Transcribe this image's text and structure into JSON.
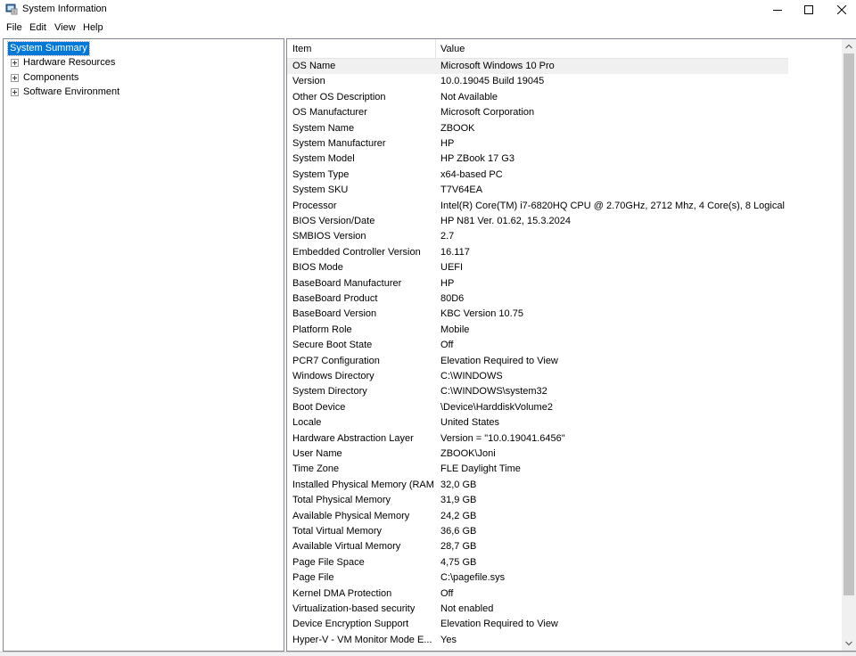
{
  "window": {
    "title": "System Information",
    "icon": "system-information-icon",
    "controls": [
      "minimize-icon",
      "maximize-icon",
      "close-icon"
    ]
  },
  "menu": {
    "file": "File",
    "edit": "Edit",
    "view": "View",
    "help": "Help"
  },
  "tree": {
    "selected": "System Summary",
    "items": [
      "Hardware Resources",
      "Components",
      "Software Environment"
    ]
  },
  "table": {
    "headers": {
      "item": "Item",
      "value": "Value"
    },
    "rows": [
      {
        "item": "OS Name",
        "value": "Microsoft Windows 10 Pro"
      },
      {
        "item": "Version",
        "value": "10.0.19045 Build 19045"
      },
      {
        "item": "Other OS Description",
        "value": "Not Available"
      },
      {
        "item": "OS Manufacturer",
        "value": "Microsoft Corporation"
      },
      {
        "item": "System Name",
        "value": "ZBOOK"
      },
      {
        "item": "System Manufacturer",
        "value": "HP"
      },
      {
        "item": "System Model",
        "value": "HP ZBook 17 G3"
      },
      {
        "item": "System Type",
        "value": "x64-based PC"
      },
      {
        "item": "System SKU",
        "value": "T7V64EA"
      },
      {
        "item": "Processor",
        "value": "Intel(R) Core(TM) i7-6820HQ CPU @ 2.70GHz, 2712 Mhz, 4 Core(s), 8 Logical ..."
      },
      {
        "item": "BIOS Version/Date",
        "value": "HP N81 Ver. 01.62, 15.3.2024"
      },
      {
        "item": "SMBIOS Version",
        "value": "2.7"
      },
      {
        "item": "Embedded Controller Version",
        "value": "16.117"
      },
      {
        "item": "BIOS Mode",
        "value": "UEFI"
      },
      {
        "item": "BaseBoard Manufacturer",
        "value": "HP"
      },
      {
        "item": "BaseBoard Product",
        "value": "80D6"
      },
      {
        "item": "BaseBoard Version",
        "value": "KBC Version 10.75"
      },
      {
        "item": "Platform Role",
        "value": "Mobile"
      },
      {
        "item": "Secure Boot State",
        "value": "Off"
      },
      {
        "item": "PCR7 Configuration",
        "value": "Elevation Required to View"
      },
      {
        "item": "Windows Directory",
        "value": "C:\\WINDOWS"
      },
      {
        "item": "System Directory",
        "value": "C:\\WINDOWS\\system32"
      },
      {
        "item": "Boot Device",
        "value": "\\Device\\HarddiskVolume2"
      },
      {
        "item": "Locale",
        "value": "United States"
      },
      {
        "item": "Hardware Abstraction Layer",
        "value": "Version = \"10.0.19041.6456\""
      },
      {
        "item": "User Name",
        "value": "ZBOOK\\Joni"
      },
      {
        "item": "Time Zone",
        "value": "FLE Daylight Time"
      },
      {
        "item": "Installed Physical Memory (RAM)",
        "value": "32,0 GB"
      },
      {
        "item": "Total Physical Memory",
        "value": "31,9 GB"
      },
      {
        "item": "Available Physical Memory",
        "value": "24,2 GB"
      },
      {
        "item": "Total Virtual Memory",
        "value": "36,6 GB"
      },
      {
        "item": "Available Virtual Memory",
        "value": "28,7 GB"
      },
      {
        "item": "Page File Space",
        "value": "4,75 GB"
      },
      {
        "item": "Page File",
        "value": "C:\\pagefile.sys"
      },
      {
        "item": "Kernel DMA Protection",
        "value": "Off"
      },
      {
        "item": "Virtualization-based security",
        "value": "Not enabled"
      },
      {
        "item": "Device Encryption Support",
        "value": "Elevation Required to View"
      },
      {
        "item": "Hyper-V - VM Monitor Mode E...",
        "value": "Yes"
      }
    ]
  },
  "colors": {
    "selection": "#0078d7",
    "row_highlight": "#f0f0f0",
    "border": "#828790"
  }
}
